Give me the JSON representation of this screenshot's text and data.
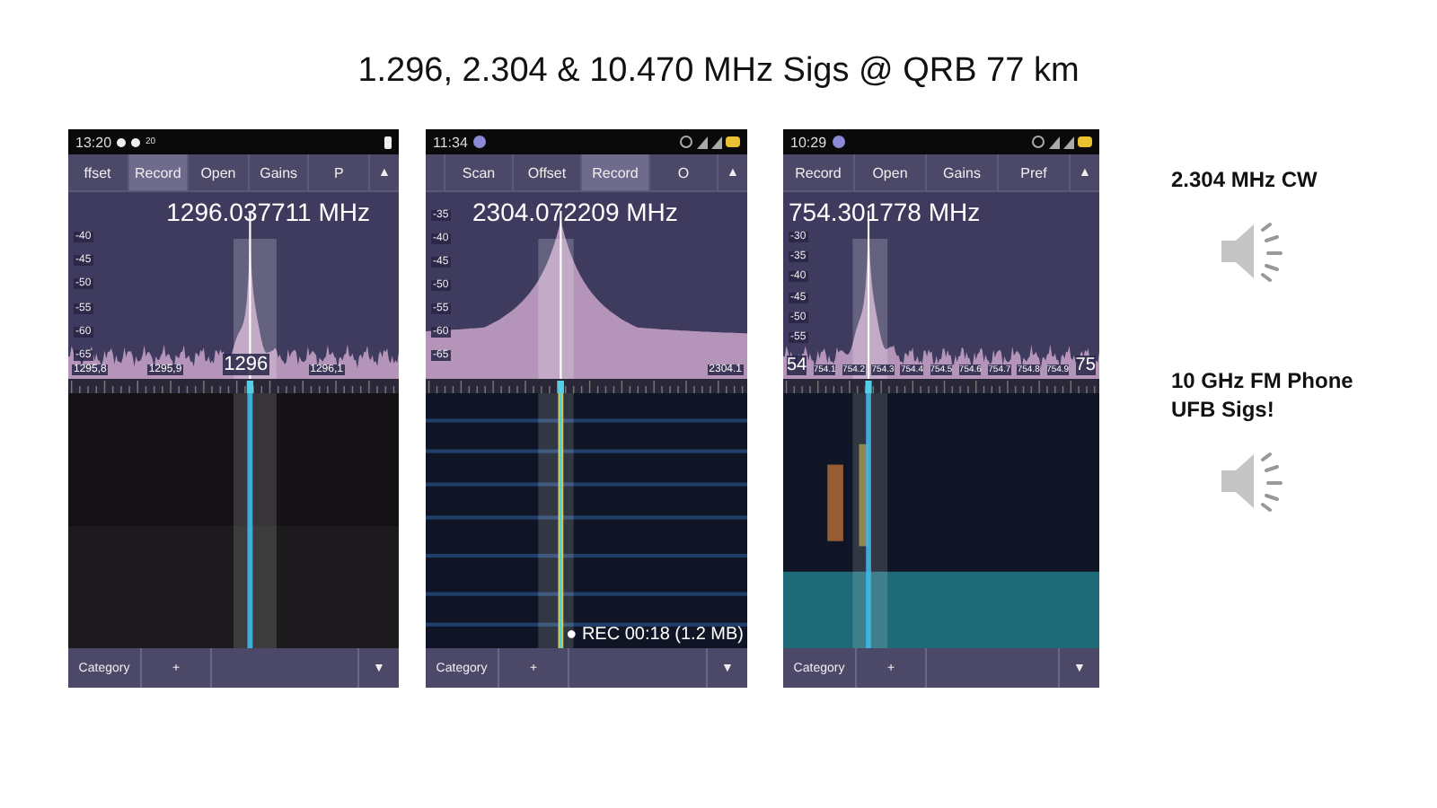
{
  "title": "1.296, 2.304 & 10.470 MHz Sigs @ QRB 77 km",
  "phones": [
    {
      "time": "13:20",
      "status_extra": "20",
      "tabs": [
        {
          "label": "ffset",
          "selected": false
        },
        {
          "label": "Record",
          "selected": true
        },
        {
          "label": "Open",
          "selected": false
        },
        {
          "label": "Gains",
          "selected": false
        },
        {
          "label": "P",
          "selected": false
        }
      ],
      "menu_toggle": "▲",
      "frequency": "1296.037711 MHz",
      "db_labels": [
        "-40",
        "-45",
        "-50",
        "-55",
        "-60",
        "-65"
      ],
      "freq_labels": [
        {
          "text": "1295,8",
          "major": false
        },
        {
          "text": "1295,9",
          "major": false
        },
        {
          "text": "1296",
          "major": true
        },
        {
          "text": "1296,1",
          "major": false
        }
      ],
      "bottom_bar": {
        "category": "Category",
        "add": "+",
        "toggle": "▼"
      }
    },
    {
      "time": "11:34",
      "tabs": [
        {
          "label": "Scan",
          "selected": false
        },
        {
          "label": "Offset",
          "selected": false
        },
        {
          "label": "Record",
          "selected": true
        },
        {
          "label": "O",
          "selected": false
        }
      ],
      "menu_toggle": "▲",
      "frequency": "2304.072209 MHz",
      "db_labels": [
        "-35",
        "-40",
        "-45",
        "-50",
        "-55",
        "-60",
        "-65"
      ],
      "freq_labels": [
        {
          "text": "2304.1",
          "major": false
        }
      ],
      "recording": "● REC 00:18 (1.2 MB)",
      "bottom_bar": {
        "category": "Category",
        "add": "+",
        "toggle": "▼"
      }
    },
    {
      "time": "10:29",
      "tabs": [
        {
          "label": "Record",
          "selected": false
        },
        {
          "label": "Open",
          "selected": false
        },
        {
          "label": "Gains",
          "selected": false
        },
        {
          "label": "Pref",
          "selected": false
        }
      ],
      "menu_toggle": "▲",
      "frequency": "754.301778 MHz",
      "db_labels": [
        "-30",
        "-35",
        "-40",
        "-45",
        "-50",
        "-55"
      ],
      "freq_labels": [
        {
          "text": "54",
          "major": true
        },
        {
          "text": "754.1",
          "major": false
        },
        {
          "text": "754.2",
          "major": false
        },
        {
          "text": "754.3",
          "major": false
        },
        {
          "text": "754.4",
          "major": false
        },
        {
          "text": "754.5",
          "major": false
        },
        {
          "text": "754.6",
          "major": false
        },
        {
          "text": "754.7",
          "major": false
        },
        {
          "text": "754.8",
          "major": false
        },
        {
          "text": "754.9",
          "major": false
        },
        {
          "text": "75",
          "major": true
        }
      ],
      "bottom_bar": {
        "category": "Category",
        "add": "+",
        "toggle": "▼"
      }
    }
  ],
  "audio_clips": [
    {
      "label": "2.304 MHz CW"
    },
    {
      "label": "10 GHz FM Phone UFB Sigs!"
    }
  ]
}
